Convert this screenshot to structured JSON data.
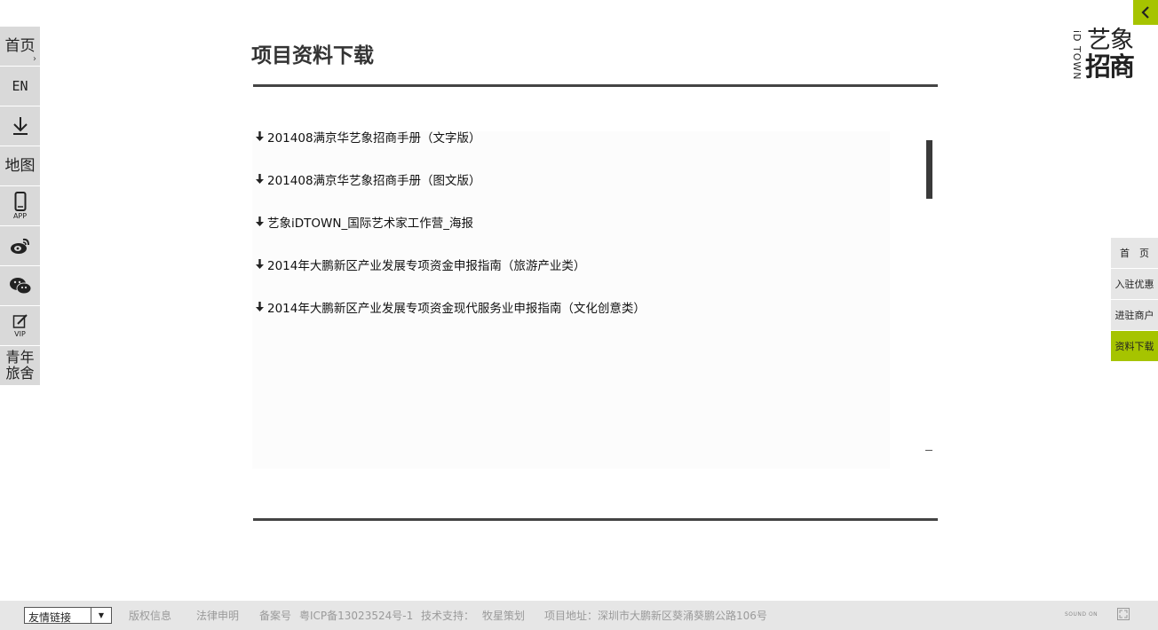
{
  "left_nav": {
    "home": "首页",
    "home_arrow": "›",
    "en": "EN",
    "map": "地图",
    "app": "APP",
    "vip": "VIP",
    "hostel_line1": "青年",
    "hostel_line2": "旅舍"
  },
  "logo": {
    "vertical": "iD TOWN",
    "line1": "艺象",
    "line2": "招商"
  },
  "right_nav": {
    "items": [
      "首　页",
      "入驻优惠",
      "进驻商户",
      "资料下载"
    ],
    "active": "资料下载"
  },
  "page": {
    "title": "项目资料下载"
  },
  "files": [
    "201408满京华艺象招商手册（文字版）",
    "201408满京华艺象招商手册（图文版）",
    "艺象iDTOWN_国际艺术家工作营_海报",
    "2014年大鹏新区产业发展专项资金申报指南（旅游产业类）",
    "2014年大鹏新区产业发展专项资金现代服务业申报指南（文化创意类）"
  ],
  "footer": {
    "links_select": "友情链接",
    "copyright": "版权信息",
    "legal": "法律申明",
    "icp_label": "备案号",
    "icp_value": "粤ICP备13023524号-1",
    "tech_label": "技术支持：",
    "tech_value": "牧星策划",
    "address": "项目地址：深圳市大鹏新区葵涌葵鹏公路106号",
    "sound": "SOUND ON"
  },
  "colors": {
    "accent": "#a6c400",
    "sidebar_bg": "#d9d9d9",
    "rule": "#444444"
  }
}
